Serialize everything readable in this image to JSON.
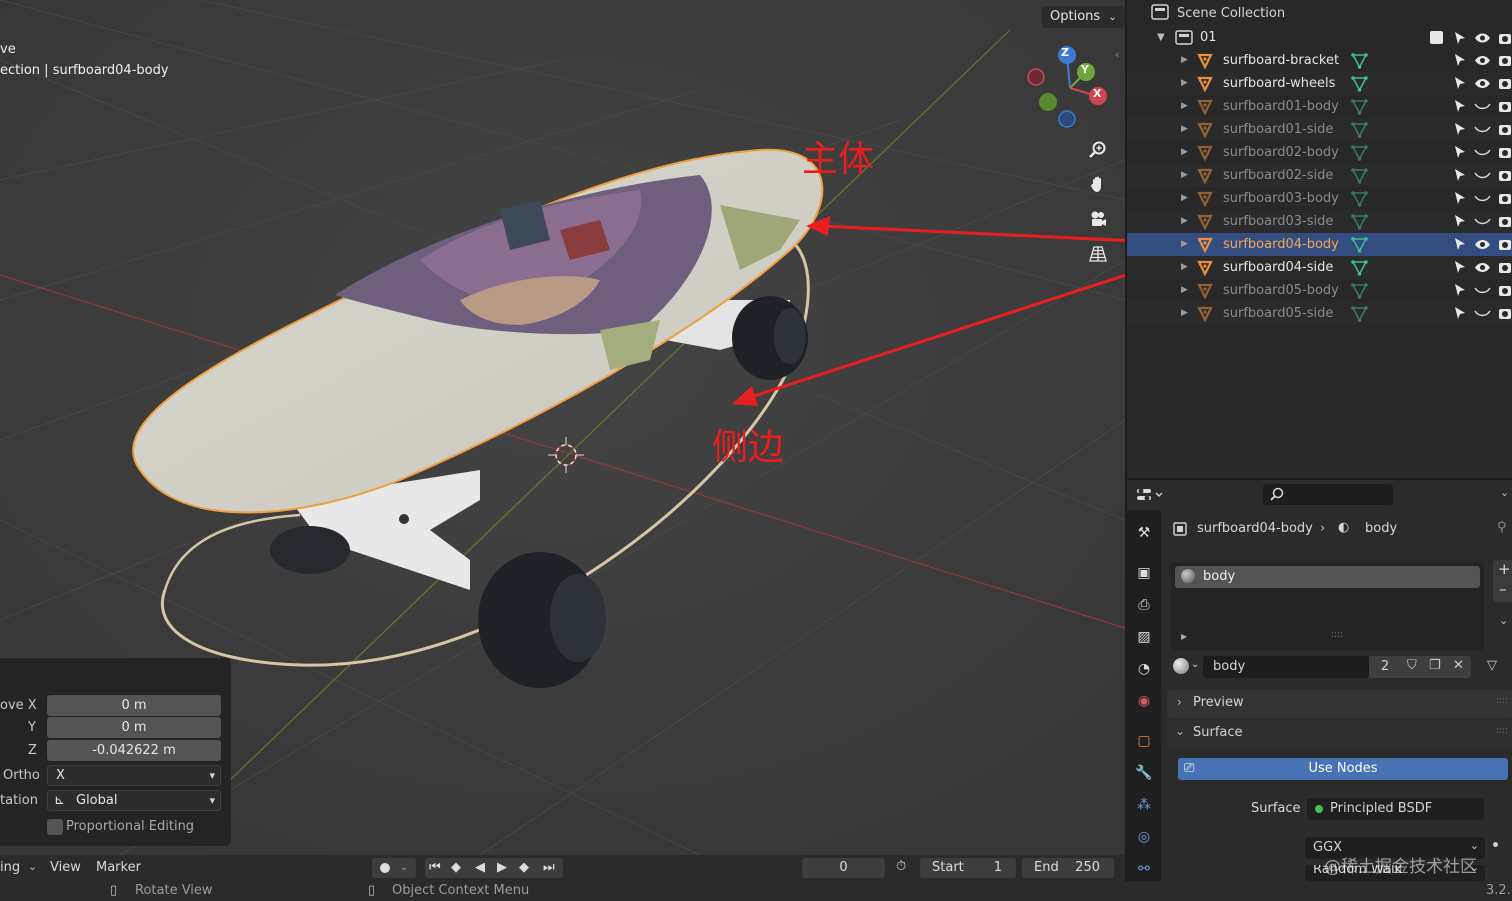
{
  "viewport": {
    "mode_line": "ve",
    "collection_line": "ection | surfboard04-body",
    "options_label": "Options",
    "gizmo": {
      "z": "Z",
      "y": "Y",
      "x": "X"
    },
    "annotations": {
      "body": "主体",
      "side": "侧边"
    }
  },
  "operator_panel": {
    "move_x_label": "ove X",
    "move_x": "0 m",
    "y_label": "Y",
    "y": "0 m",
    "z_label": "Z",
    "z": "-0.042622 m",
    "ortho_label": "Ortho",
    "ortho": "X",
    "orientation_label": "tation",
    "orientation": "Global",
    "proportional": "Proportional Editing"
  },
  "outliner": {
    "scene_collection": "Scene Collection",
    "collection": "01",
    "items": [
      {
        "label": "surfboard-bracket",
        "state": "visible"
      },
      {
        "label": "surfboard-wheels",
        "state": "visible"
      },
      {
        "label": "surfboard01-body",
        "state": "hidden"
      },
      {
        "label": "surfboard01-side",
        "state": "hidden"
      },
      {
        "label": "surfboard02-body",
        "state": "hidden"
      },
      {
        "label": "surfboard02-side",
        "state": "hidden"
      },
      {
        "label": "surfboard03-body",
        "state": "hidden"
      },
      {
        "label": "surfboard03-side",
        "state": "hidden"
      },
      {
        "label": "surfboard04-body",
        "state": "selected"
      },
      {
        "label": "surfboard04-side",
        "state": "visible"
      },
      {
        "label": "surfboard05-body",
        "state": "hidden"
      },
      {
        "label": "surfboard05-side",
        "state": "hidden"
      }
    ]
  },
  "properties": {
    "breadcrumb_object": "surfboard04-body",
    "breadcrumb_material": "body",
    "slot_name": "body",
    "material_name": "body",
    "users": "2",
    "preview_label": "Preview",
    "surface_panel_label": "Surface",
    "use_nodes_label": "Use Nodes",
    "surface_label": "Surface",
    "surface_value": "Principled BSDF",
    "distribution": "GGX",
    "subsurface": "Random Walk"
  },
  "timeline": {
    "menu_playback": "ing",
    "menu_view": "View",
    "menu_marker": "Marker",
    "current_frame": "0",
    "start_label": "Start",
    "start_value": "1",
    "end_label": "End",
    "end_value": "250"
  },
  "statusbar": {
    "rotate_view": "Rotate View",
    "context_menu": "Object Context Menu",
    "version": "3.2.",
    "watermark": "@稀土掘金技术社区"
  },
  "colors": {
    "accent_blue": "#4772b3",
    "selection_orange": "#f2a850",
    "annotation_red": "#e81e1e",
    "mesh_green": "#3fbf8f"
  }
}
